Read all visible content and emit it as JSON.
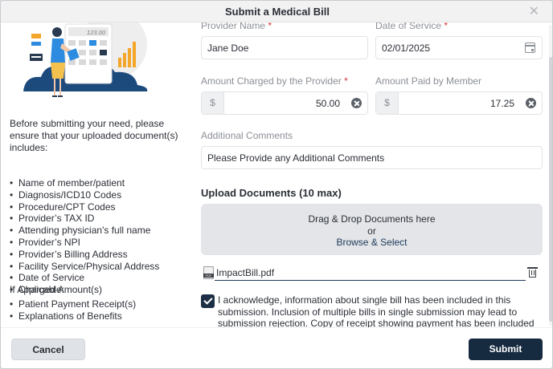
{
  "dialog": {
    "title": "Submit a Medical Bill"
  },
  "illustration": {
    "screen_value": "123.00"
  },
  "instructions": {
    "intro": "Before submitting your need, please ensure that your uploaded document(s) includes:",
    "required_items": [
      "Name of member/patient",
      "Diagnosis/ICD10 Codes",
      "Procedure/CPT Codes",
      "Provider’s TAX ID",
      "Attending physician's full name",
      "Provider’s NPI",
      "Provider’s Billing Address",
      "Facility Service/Physical Address",
      "Date of Service",
      "Charged Amount(s)"
    ],
    "if_applicable_label": "If Applicable:",
    "if_applicable_items": [
      "Patient Payment Receipt(s)",
      "Explanations of Benefits"
    ]
  },
  "form": {
    "provider_name": {
      "label": "Provider Name",
      "required_mark": "*",
      "value": "Jane Doe"
    },
    "date_of_service": {
      "label": "Date of Service",
      "required_mark": "*",
      "value": "02/01/2025"
    },
    "amount_charged": {
      "label": "Amount Charged by the Provider",
      "required_mark": "*",
      "prefix": "$",
      "value": "50.00"
    },
    "amount_paid": {
      "label": "Amount Paid by Member",
      "prefix": "$",
      "value": "17.25"
    },
    "comments": {
      "label": "Additional Comments",
      "value": "Please Provide any Additional Comments"
    }
  },
  "upload": {
    "title": "Upload Documents (10 max)",
    "drop_text": "Drag & Drop Documents here",
    "or_text": "or",
    "browse_text": "Browse & Select",
    "files": [
      {
        "name": "ImpactBill.pdf",
        "badge": "PDF"
      }
    ]
  },
  "acknowledgement": {
    "checked": true,
    "text": "I acknowledge, information about single bill has been included in this submission. Inclusion of multiple bills in single submission may lead to submission rejection. Copy of receipt showing payment has been included in"
  },
  "footer": {
    "cancel_label": "Cancel",
    "submit_label": "Submit"
  },
  "colors": {
    "primary": "#162a40",
    "required": "#d8343c",
    "dropzone": "#e3e5e8"
  }
}
